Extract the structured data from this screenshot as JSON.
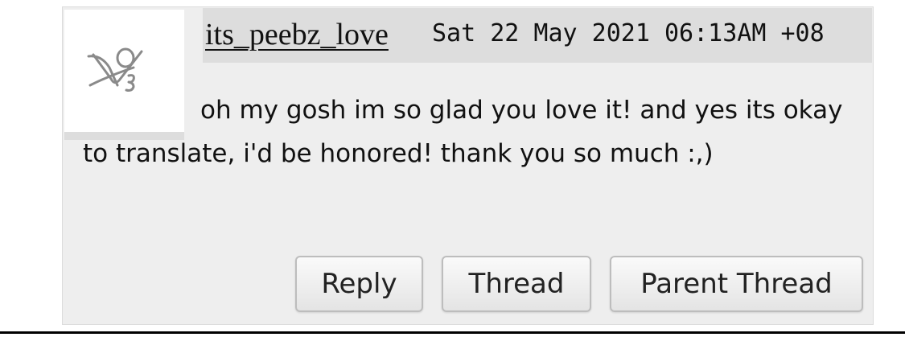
{
  "comment": {
    "author": "its_peebz_love",
    "datetime": "Sat 22 May 2021 06:13AM +08",
    "body": "oh my gosh im so glad you love it! and yes its okay to translate, i'd be honored! thank you so much :,)"
  },
  "actions": {
    "reply_label": "Reply",
    "thread_label": "Thread",
    "parent_thread_label": "Parent Thread"
  },
  "avatar": {
    "icon": "user-avatar-icon"
  }
}
